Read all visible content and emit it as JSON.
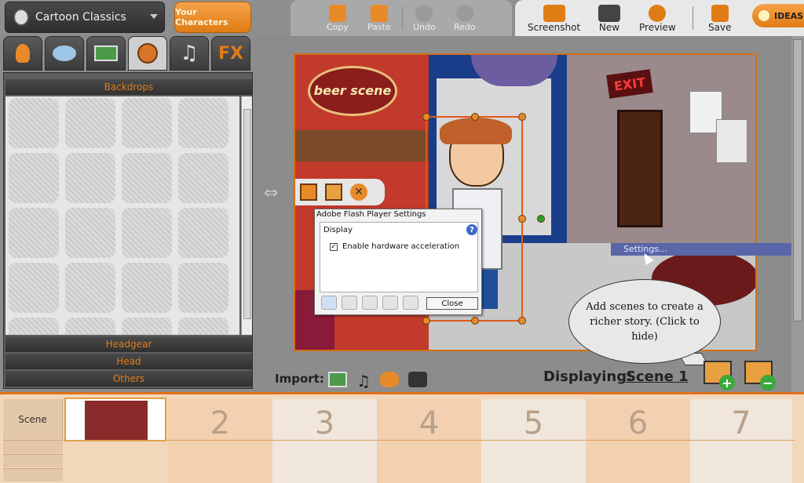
{
  "toolbar": {
    "theme_label": "Cartoon Classics",
    "your_characters": "Your Characters",
    "copy": "Copy",
    "paste": "Paste",
    "undo": "Undo",
    "redo": "Redo",
    "screenshot": "Screenshot",
    "new": "New",
    "preview": "Preview",
    "save": "Save",
    "ideas": "IDEAS"
  },
  "left_panel": {
    "sections": [
      "Backdrops",
      "Headgear",
      "Head",
      "Others"
    ],
    "active_tab": "props-ball",
    "tabs": [
      "character-icon",
      "speech-bubble-icon",
      "landscape-icon",
      "ball-icon",
      "music-note-icon"
    ],
    "fx_label": "FX"
  },
  "stage": {
    "beer_sign": "beer scene",
    "exit_sign": "EXIT"
  },
  "flash_dialog": {
    "title": "Adobe Flash Player Settings",
    "tab": "Display",
    "checkbox_label": "Enable hardware acceleration",
    "checked": true,
    "close_label": "Close",
    "help_label": "?"
  },
  "context_menu": {
    "item": "Settings..."
  },
  "tip": {
    "text": "Add scenes to create a richer story. (Click to hide)"
  },
  "import_bar": {
    "label": "Import:",
    "displaying_label": "Displaying:",
    "scene_name": "Scene 1"
  },
  "timeline": {
    "head_label": "Scene",
    "slots": [
      "2",
      "3",
      "4",
      "5",
      "6",
      "7"
    ]
  },
  "colors": {
    "accent": "#e07c14",
    "selection": "#5966a8"
  }
}
